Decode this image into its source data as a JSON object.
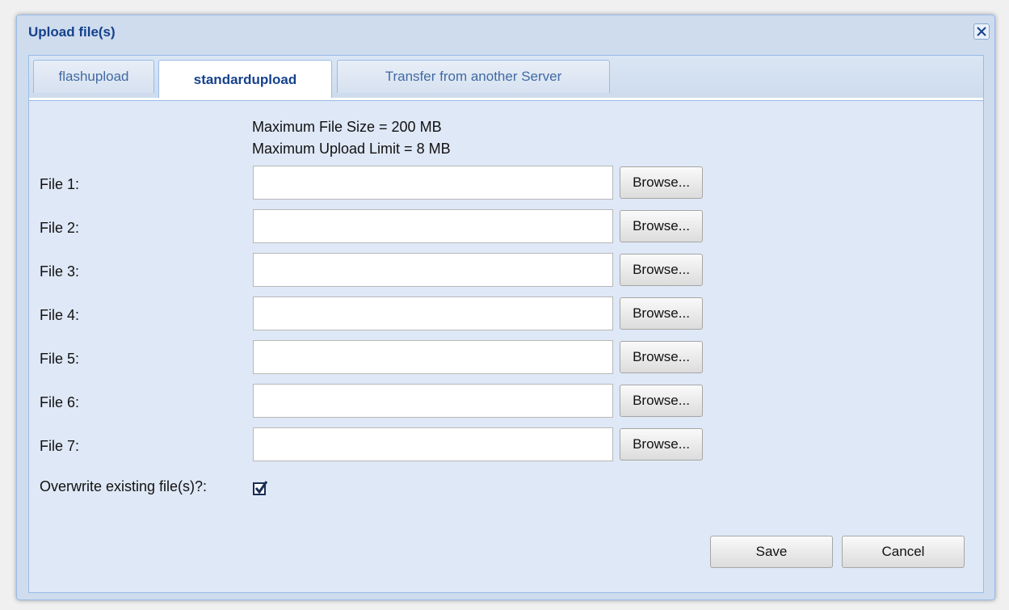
{
  "dialog": {
    "title": "Upload file(s)"
  },
  "tabs": [
    {
      "label": "flashupload",
      "active": false
    },
    {
      "label": "standardupload",
      "active": true
    },
    {
      "label": "Transfer from another Server",
      "active": false
    }
  ],
  "info": {
    "max_file_size": "Maximum File Size = 200 MB",
    "max_upload_limit": "Maximum Upload Limit = 8 MB"
  },
  "files": [
    {
      "label": "File 1:",
      "value": "",
      "browse_label": "Browse..."
    },
    {
      "label": "File 2:",
      "value": "",
      "browse_label": "Browse..."
    },
    {
      "label": "File 3:",
      "value": "",
      "browse_label": "Browse..."
    },
    {
      "label": "File 4:",
      "value": "",
      "browse_label": "Browse..."
    },
    {
      "label": "File 5:",
      "value": "",
      "browse_label": "Browse..."
    },
    {
      "label": "File 6:",
      "value": "",
      "browse_label": "Browse..."
    },
    {
      "label": "File 7:",
      "value": "",
      "browse_label": "Browse..."
    }
  ],
  "overwrite": {
    "label": "Overwrite existing file(s)?:",
    "checked": true
  },
  "actions": {
    "save_label": "Save",
    "cancel_label": "Cancel"
  },
  "colors": {
    "title": "#15428b",
    "panel_bg": "#dfe8f6",
    "border": "#99bbe8"
  },
  "icons": {
    "close": "close-icon",
    "checkbox": "checkmark-icon"
  }
}
